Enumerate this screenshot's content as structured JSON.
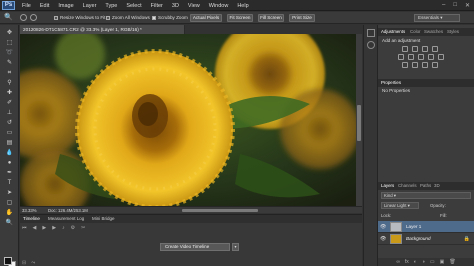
{
  "menubar": {
    "logo": "Ps",
    "items": [
      "File",
      "Edit",
      "Image",
      "Layer",
      "Type",
      "Select",
      "Filter",
      "3D",
      "View",
      "Window",
      "Help"
    ],
    "window_controls": [
      "–",
      "□",
      "✕"
    ]
  },
  "options": {
    "resize_windows": "Resize Windows to Fit",
    "zoom_all": "Zoom All Windows",
    "scrubby_zoom": "Scrubby Zoom",
    "actual_pixels": "Actual Pixels",
    "fit_screen": "Fit Screen",
    "fill_screen": "Fill Screen",
    "print_size": "Print Size",
    "workspace": "Essentials"
  },
  "document": {
    "tab_title": "20120826-DT1C5871.CR2 @ 33.3% (Layer 1, RGB/16) *",
    "zoom": "33.33%",
    "doc_info": "Doc: 126.4M/253.1M"
  },
  "timeline": {
    "tabs": [
      "Timeline",
      "Measurement Log",
      "Mini Bridge"
    ],
    "create_button": "Create Video Timeline",
    "dropdown": "▾"
  },
  "panels": {
    "adjustments_tabs": [
      "Adjustments",
      "Color",
      "Swatches",
      "Styles"
    ],
    "adjustments_title": "Add an adjustment",
    "properties_tab": "Properties",
    "properties_title": "No Properties",
    "layers_tabs": [
      "Layers",
      "Channels",
      "Paths",
      "3D"
    ],
    "kind": "Kind",
    "blend_mode": "Linear Light",
    "opacity": "Opacity:",
    "lock": "Lock:",
    "fill": "Fill:",
    "layers": [
      {
        "name": "Layer 1",
        "selected": true
      },
      {
        "name": "Background",
        "selected": false
      }
    ]
  }
}
